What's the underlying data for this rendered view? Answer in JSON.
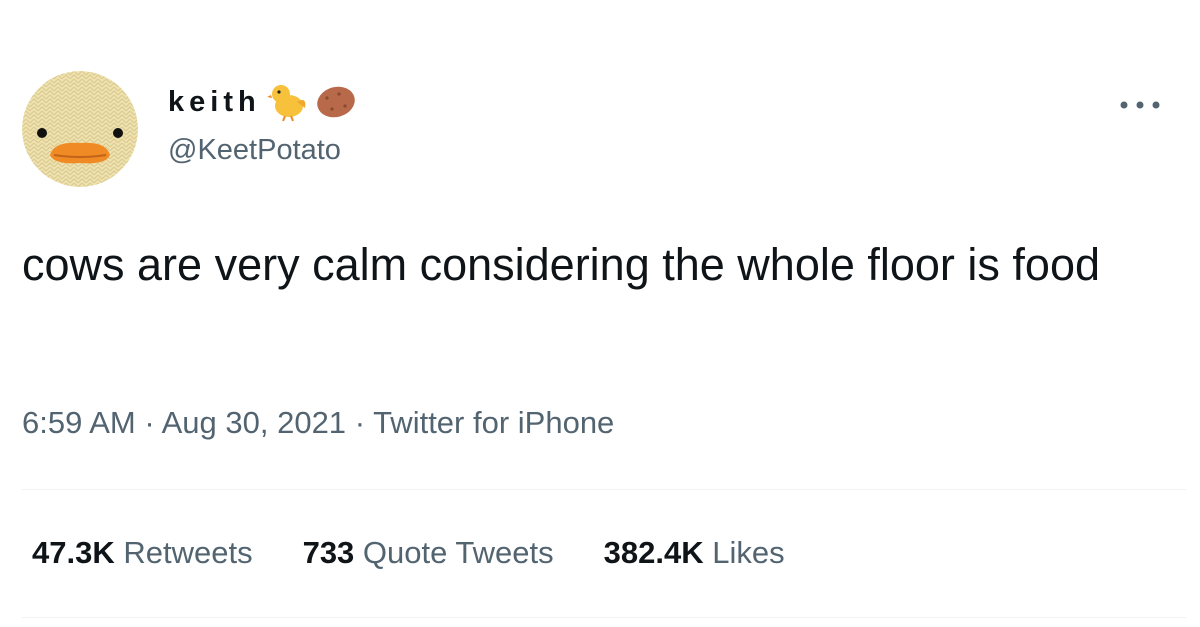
{
  "author": {
    "display_name": "keith",
    "handle": "@KeetPotato",
    "name_emojis": [
      "baby-chick-icon",
      "potato-icon"
    ],
    "avatar": "duck-face-avatar"
  },
  "tweet": {
    "text": "cows are very calm considering the whole floor is food",
    "time": "6:59 AM",
    "separator": "·",
    "date": "Aug 30, 2021",
    "source": "Twitter for iPhone"
  },
  "stats": {
    "retweets": {
      "count": "47.3K",
      "label": "Retweets"
    },
    "quote_tweets": {
      "count": "733",
      "label": "Quote Tweets"
    },
    "likes": {
      "count": "382.4K",
      "label": "Likes"
    }
  },
  "colors": {
    "text_primary": "#0f1419",
    "text_secondary": "#536471",
    "divider": "#eff3f4"
  }
}
